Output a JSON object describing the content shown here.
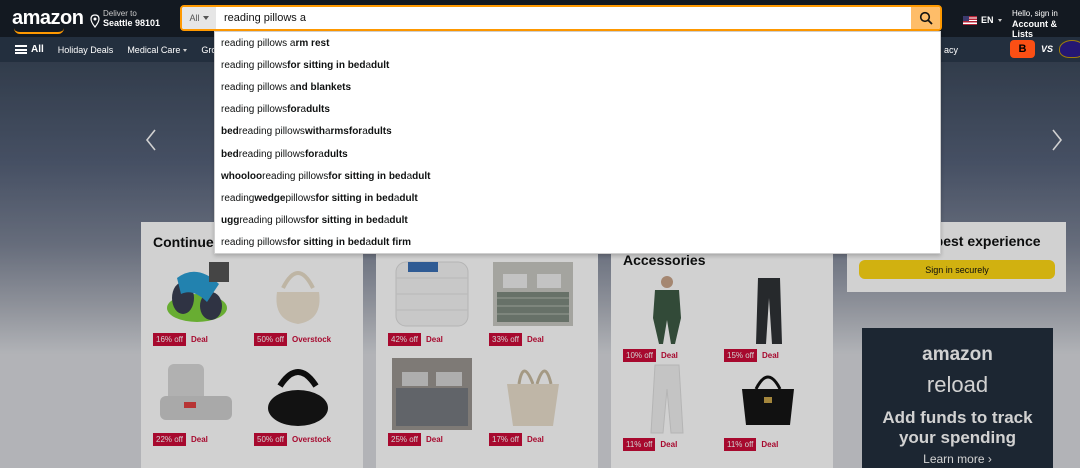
{
  "header": {
    "logo": "amazon",
    "deliver_line1": "Deliver to",
    "deliver_line2": "Seattle 98101",
    "search_category": "All",
    "search_value": "reading pillows a",
    "lang": "EN",
    "account_line1": "Hello, sign in",
    "account_line2": "Account & Lists"
  },
  "subnav": {
    "all_label": "All",
    "links": [
      "Holiday Deals",
      "Medical Care",
      "Gro"
    ],
    "right_partial": "acy",
    "promo_vs": "VS",
    "promo_team_a": "B"
  },
  "suggestions": [
    [
      {
        "t": "reading pillows a",
        "b": false
      },
      {
        "t": "rm rest",
        "b": true
      }
    ],
    [
      {
        "t": "reading pillows ",
        "b": false
      },
      {
        "t": "for sitting in bed ",
        "b": true
      },
      {
        "t": "a",
        "b": false
      },
      {
        "t": "dult",
        "b": true
      }
    ],
    [
      {
        "t": "reading pillows a",
        "b": false
      },
      {
        "t": "nd blankets",
        "b": true
      }
    ],
    [
      {
        "t": "reading pillows ",
        "b": false
      },
      {
        "t": "for ",
        "b": true
      },
      {
        "t": "a",
        "b": false
      },
      {
        "t": "dults",
        "b": true
      }
    ],
    [
      {
        "t": "bed ",
        "b": true
      },
      {
        "t": "reading pillows ",
        "b": false
      },
      {
        "t": "with ",
        "b": true
      },
      {
        "t": "a",
        "b": false
      },
      {
        "t": "rms ",
        "b": true
      },
      {
        "t": "for ",
        "b": true
      },
      {
        "t": "a",
        "b": false
      },
      {
        "t": "dults",
        "b": true
      }
    ],
    [
      {
        "t": "bed ",
        "b": true
      },
      {
        "t": "reading pillows ",
        "b": false
      },
      {
        "t": "for ",
        "b": true
      },
      {
        "t": "a",
        "b": false
      },
      {
        "t": "dults",
        "b": true
      }
    ],
    [
      {
        "t": "whooloo ",
        "b": true
      },
      {
        "t": "reading pillows ",
        "b": false
      },
      {
        "t": "for sitting in bed ",
        "b": true
      },
      {
        "t": "a",
        "b": false
      },
      {
        "t": "dult",
        "b": true
      }
    ],
    [
      {
        "t": "reading ",
        "b": false
      },
      {
        "t": "wedge ",
        "b": true
      },
      {
        "t": "pillows ",
        "b": false
      },
      {
        "t": "for sitting in bed ",
        "b": true
      },
      {
        "t": "a",
        "b": false
      },
      {
        "t": "dult",
        "b": true
      }
    ],
    [
      {
        "t": "ugg ",
        "b": true
      },
      {
        "t": "reading pillows ",
        "b": false
      },
      {
        "t": "for sitting in bed ",
        "b": true
      },
      {
        "t": "a",
        "b": false
      },
      {
        "t": "dult",
        "b": true
      }
    ],
    [
      {
        "t": "reading pillows ",
        "b": false
      },
      {
        "t": "for sitting in bed ",
        "b": true
      },
      {
        "t": "a",
        "b": false
      },
      {
        "t": "dult firm",
        "b": true
      }
    ]
  ],
  "cards": {
    "card1_title": "Continue",
    "card3_title": "Accessories",
    "right_title": "e best experience",
    "signin_label": "Sign in securely",
    "card1_products": [
      {
        "pct": "16% off",
        "label": "Deal"
      },
      {
        "pct": "50% off",
        "label": "Overstock"
      },
      {
        "pct": "22% off",
        "label": "Deal"
      },
      {
        "pct": "50% off",
        "label": "Overstock"
      }
    ],
    "card2_products": [
      {
        "pct": "42% off",
        "label": "Deal"
      },
      {
        "pct": "33% off",
        "label": "Deal"
      },
      {
        "pct": "25% off",
        "label": "Deal"
      },
      {
        "pct": "17% off",
        "label": "Deal"
      }
    ],
    "card3_products": [
      {
        "pct": "10% off",
        "label": "Deal"
      },
      {
        "pct": "15% off",
        "label": "Deal"
      },
      {
        "pct": "11% off",
        "label": "Deal"
      },
      {
        "pct": "11% off",
        "label": "Deal"
      }
    ],
    "reload_logo": "amazon",
    "reload_word": "reload",
    "reload_headline": "Add funds to track your spending",
    "reload_more": "Learn more ›"
  },
  "colors": {
    "nav_dark": "#131921",
    "nav_sub": "#232f3e",
    "accent": "#febd69",
    "deal_red": "#cc0c39"
  }
}
